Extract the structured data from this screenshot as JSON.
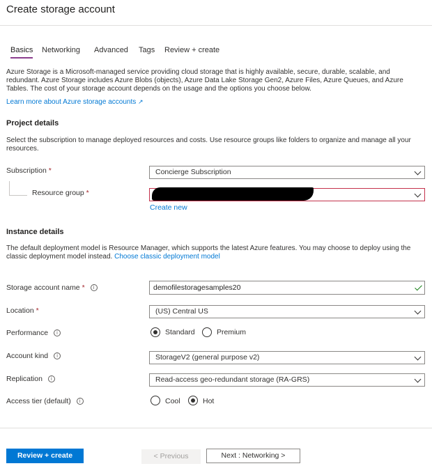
{
  "header": {
    "title": "Create storage account"
  },
  "tabs": [
    {
      "label": "Basics"
    },
    {
      "label": "Networking"
    },
    {
      "label": "Advanced"
    },
    {
      "label": "Tags"
    },
    {
      "label": "Review + create"
    }
  ],
  "intro": {
    "text": "Azure Storage is a Microsoft-managed service providing cloud storage that is highly available, secure, durable, scalable, and redundant. Azure Storage includes Azure Blobs (objects), Azure Data Lake Storage Gen2, Azure Files, Azure Queues, and Azure Tables. The cost of your storage account depends on the usage and the options you choose below.",
    "link": "Learn more about Azure storage accounts",
    "link_icon": "external-link-icon"
  },
  "project": {
    "title": "Project details",
    "description": "Select the subscription to manage deployed resources and costs. Use resource groups like folders to organize and manage all your resources.",
    "subscription_label": "Subscription",
    "subscription_value": "Concierge Subscription",
    "resource_group_label": "Resource group",
    "resource_group_value": "",
    "create_new": "Create new"
  },
  "instance": {
    "title": "Instance details",
    "description": "The default deployment model is Resource Manager, which supports the latest Azure features. You may choose to deploy using the classic deployment model instead.",
    "classic_link": "Choose classic deployment model",
    "name_label": "Storage account name",
    "name_value": "demofilestoragesamples20",
    "location_label": "Location",
    "location_value": "(US) Central US",
    "performance_label": "Performance",
    "performance_options": [
      "Standard",
      "Premium"
    ],
    "performance_selected": "Standard",
    "account_kind_label": "Account kind",
    "account_kind_value": "StorageV2 (general purpose v2)",
    "replication_label": "Replication",
    "replication_value": "Read-access geo-redundant storage (RA-GRS)",
    "access_tier_label": "Access tier (default)",
    "access_tier_options": [
      "Cool",
      "Hot"
    ],
    "access_tier_selected": "Hot"
  },
  "required_marker": "*",
  "info_glyph": "i",
  "footer": {
    "review_create": "Review + create",
    "previous": "< Previous",
    "next": "Next : Networking >"
  },
  "colors": {
    "accent": "#0078d4",
    "tab_underline": "#8a3d8e",
    "required": "#a4262c",
    "valid": "#107c10"
  }
}
